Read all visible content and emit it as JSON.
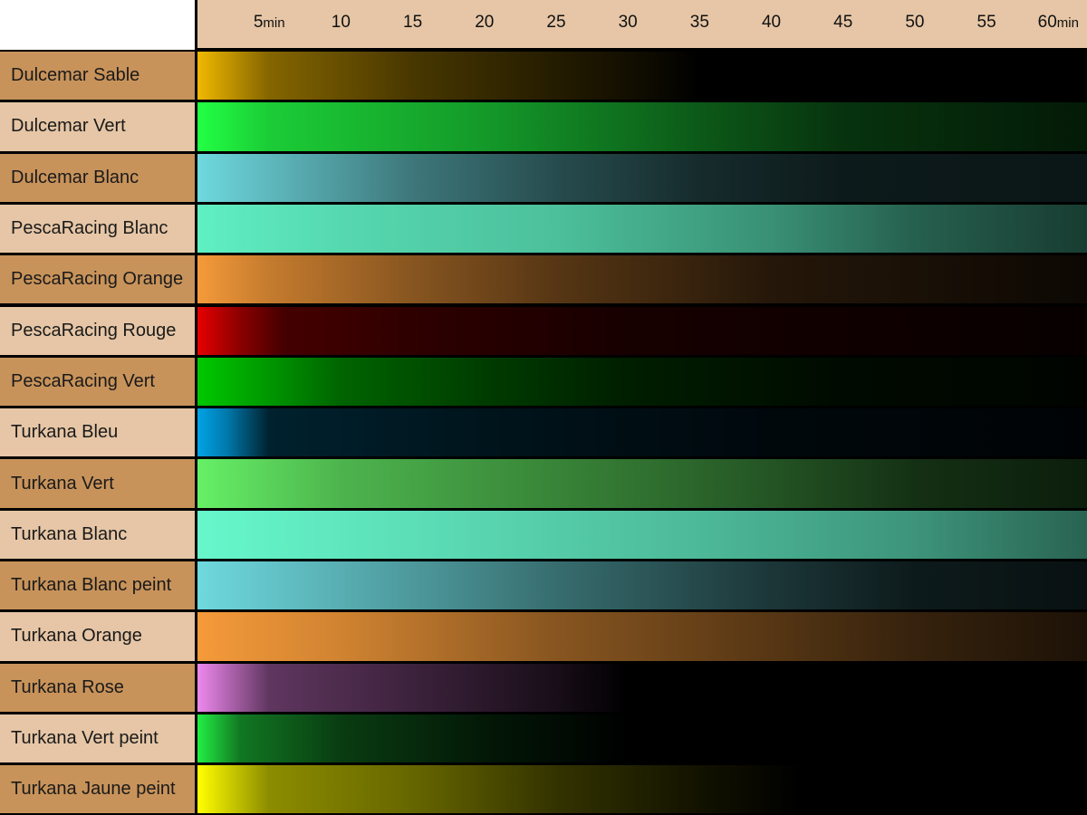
{
  "chart_data": {
    "type": "heatmap",
    "title": "",
    "xlabel": "",
    "ylabel": "",
    "x_unit": "min",
    "x_ticks": [
      5,
      10,
      15,
      20,
      25,
      30,
      35,
      40,
      45,
      50,
      55,
      60
    ],
    "x_tick_labels": [
      "5",
      "10",
      "15",
      "20",
      "25",
      "30",
      "35",
      "40",
      "45",
      "50",
      "55",
      "60"
    ],
    "xlim": [
      0,
      62
    ],
    "label_colors": [
      "#c8935a",
      "#e6c6a6"
    ],
    "header_color": "#e6c6a6",
    "rows": [
      {
        "name": "Dulcemar Sable",
        "color": "#f0b800",
        "stops": [
          {
            "t": 0,
            "level": 1.0
          },
          {
            "t": 5,
            "level": 0.55
          },
          {
            "t": 15,
            "level": 0.3
          },
          {
            "t": 25,
            "level": 0.15
          },
          {
            "t": 32,
            "level": 0.05
          },
          {
            "t": 35,
            "level": 0
          },
          {
            "t": 62,
            "level": 0
          }
        ]
      },
      {
        "name": "Dulcemar Vert",
        "color": "#22ff44",
        "stops": [
          {
            "t": 0,
            "level": 1.0
          },
          {
            "t": 5,
            "level": 0.8
          },
          {
            "t": 20,
            "level": 0.6
          },
          {
            "t": 35,
            "level": 0.35
          },
          {
            "t": 45,
            "level": 0.2
          },
          {
            "t": 62,
            "level": 0.1
          }
        ]
      },
      {
        "name": "Dulcemar Blanc",
        "color": "#6ed9de",
        "stops": [
          {
            "t": 0,
            "level": 1.0
          },
          {
            "t": 5,
            "level": 0.85
          },
          {
            "t": 15,
            "level": 0.55
          },
          {
            "t": 25,
            "level": 0.35
          },
          {
            "t": 35,
            "level": 0.2
          },
          {
            "t": 45,
            "level": 0.12
          },
          {
            "t": 62,
            "level": 0.1
          }
        ]
      },
      {
        "name": "PescaRacing Blanc",
        "color": "#5ff0c2",
        "stops": [
          {
            "t": 0,
            "level": 1.0
          },
          {
            "t": 10,
            "level": 0.9
          },
          {
            "t": 25,
            "level": 0.8
          },
          {
            "t": 40,
            "level": 0.6
          },
          {
            "t": 50,
            "level": 0.4
          },
          {
            "t": 62,
            "level": 0.25
          }
        ]
      },
      {
        "name": "PescaRacing Orange",
        "color": "#f59a3a",
        "stops": [
          {
            "t": 0,
            "level": 1.0
          },
          {
            "t": 5,
            "level": 0.8
          },
          {
            "t": 15,
            "level": 0.55
          },
          {
            "t": 25,
            "level": 0.35
          },
          {
            "t": 40,
            "level": 0.15
          },
          {
            "t": 62,
            "level": 0.05
          }
        ]
      },
      {
        "name": "PescaRacing Rouge",
        "color": "#e60000",
        "stops": [
          {
            "t": 0,
            "level": 1.0
          },
          {
            "t": 3,
            "level": 0.6
          },
          {
            "t": 6,
            "level": 0.3
          },
          {
            "t": 15,
            "level": 0.2
          },
          {
            "t": 30,
            "level": 0.1
          },
          {
            "t": 62,
            "level": 0.03
          }
        ]
      },
      {
        "name": "PescaRacing Vert",
        "color": "#00c800",
        "stops": [
          {
            "t": 0,
            "level": 1.0
          },
          {
            "t": 10,
            "level": 0.5
          },
          {
            "t": 20,
            "level": 0.3
          },
          {
            "t": 30,
            "level": 0.15
          },
          {
            "t": 45,
            "level": 0.05
          },
          {
            "t": 62,
            "level": 0.02
          }
        ]
      },
      {
        "name": "Turkana Bleu",
        "color": "#00a3e6",
        "stops": [
          {
            "t": 0,
            "level": 1.0
          },
          {
            "t": 2,
            "level": 0.75
          },
          {
            "t": 5,
            "level": 0.2
          },
          {
            "t": 20,
            "level": 0.12
          },
          {
            "t": 40,
            "level": 0.05
          },
          {
            "t": 62,
            "level": 0.02
          }
        ]
      },
      {
        "name": "Turkana Vert",
        "color": "#66f066",
        "stops": [
          {
            "t": 0,
            "level": 1.0
          },
          {
            "t": 10,
            "level": 0.75
          },
          {
            "t": 25,
            "level": 0.55
          },
          {
            "t": 40,
            "level": 0.35
          },
          {
            "t": 50,
            "level": 0.2
          },
          {
            "t": 62,
            "level": 0.12
          }
        ]
      },
      {
        "name": "Turkana Blanc",
        "color": "#66f7cb",
        "stops": [
          {
            "t": 0,
            "level": 1.0
          },
          {
            "t": 15,
            "level": 0.9
          },
          {
            "t": 35,
            "level": 0.75
          },
          {
            "t": 50,
            "level": 0.6
          },
          {
            "t": 62,
            "level": 0.4
          }
        ]
      },
      {
        "name": "Turkana Blanc peint",
        "color": "#6ed9de",
        "stops": [
          {
            "t": 0,
            "level": 1.0
          },
          {
            "t": 10,
            "level": 0.8
          },
          {
            "t": 25,
            "level": 0.5
          },
          {
            "t": 40,
            "level": 0.25
          },
          {
            "t": 50,
            "level": 0.12
          },
          {
            "t": 62,
            "level": 0.08
          }
        ]
      },
      {
        "name": "Turkana Orange",
        "color": "#f59a3a",
        "stops": [
          {
            "t": 0,
            "level": 1.0
          },
          {
            "t": 10,
            "level": 0.85
          },
          {
            "t": 25,
            "level": 0.55
          },
          {
            "t": 40,
            "level": 0.35
          },
          {
            "t": 50,
            "level": 0.22
          },
          {
            "t": 62,
            "level": 0.12
          }
        ]
      },
      {
        "name": "Turkana Rose",
        "color": "#ee88ee",
        "stops": [
          {
            "t": 0,
            "level": 1.0
          },
          {
            "t": 5,
            "level": 0.4
          },
          {
            "t": 15,
            "level": 0.25
          },
          {
            "t": 25,
            "level": 0.1
          },
          {
            "t": 30,
            "level": 0
          },
          {
            "t": 62,
            "level": 0
          }
        ]
      },
      {
        "name": "Turkana Vert peint",
        "color": "#22ee44",
        "stops": [
          {
            "t": 0,
            "level": 1.0
          },
          {
            "t": 3,
            "level": 0.5
          },
          {
            "t": 10,
            "level": 0.25
          },
          {
            "t": 20,
            "level": 0.1
          },
          {
            "t": 30,
            "level": 0
          },
          {
            "t": 62,
            "level": 0
          }
        ]
      },
      {
        "name": "Turkana Jaune peint",
        "color": "#ffff00",
        "stops": [
          {
            "t": 0,
            "level": 1.0
          },
          {
            "t": 5,
            "level": 0.55
          },
          {
            "t": 15,
            "level": 0.4
          },
          {
            "t": 25,
            "level": 0.2
          },
          {
            "t": 35,
            "level": 0.07
          },
          {
            "t": 42,
            "level": 0
          },
          {
            "t": 62,
            "level": 0
          }
        ]
      }
    ]
  }
}
